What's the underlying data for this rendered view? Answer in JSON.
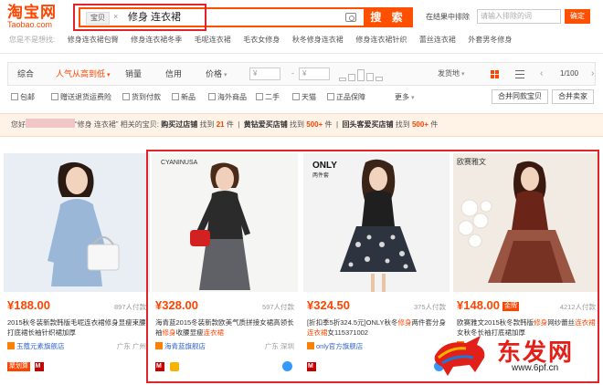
{
  "header": {
    "logo_cn": "淘宝网",
    "logo_en": "Taobao.com",
    "search": {
      "scope": "宝贝",
      "clear": "×",
      "query": "修身 连衣裙",
      "button": "搜 索"
    },
    "within": {
      "label": "在结果中排除",
      "placeholder": "请输入排除的词",
      "button": "确定"
    }
  },
  "suggestions": [
    "您是不是想找:",
    "修身连衣裙包臀",
    "修身连衣裙冬季",
    "毛呢连衣裙",
    "毛衣女修身",
    "秋冬修身连衣裙",
    "修身连衣裙针织",
    "蕾丝连衣裙",
    "外套男冬修身"
  ],
  "sortbar": {
    "tabs": [
      "综合",
      "人气从高到低",
      "销量",
      "信用",
      "价格"
    ],
    "active": 1,
    "price_from": "¥",
    "price_to": "¥",
    "location": "发货地",
    "page": "1/100",
    "prev": "‹",
    "next": "›",
    "arrow": "▾"
  },
  "filters": {
    "checks": [
      "包邮",
      "赠送退货运费险",
      "货到付款",
      "新品",
      "海外商品",
      "二手",
      "天猫",
      "正品保障"
    ],
    "more": "更多",
    "merge_same": "合并同款宝贝",
    "merge_seller": "合并卖家"
  },
  "notice": {
    "prefix": "您好",
    "query_part": "“修身 连衣裙” 相关的宝贝: ",
    "segments": [
      {
        "label": "购买过店铺",
        "pre": "找到",
        "count": "21",
        "post": "件"
      },
      {
        "label": "黄钻爱买店铺",
        "pre": "找到",
        "count": "500+",
        "post": "件"
      },
      {
        "label": "回头客爱买店铺",
        "pre": "找到",
        "count": "500+",
        "post": "件"
      }
    ]
  },
  "products": [
    {
      "price": "¥188.00",
      "paid": "897人付款",
      "title_parts": [
        "2015秋冬装新款韩版毛呢连衣裙修身显瘦束腰打底裙长袖针织裙加厚"
      ],
      "shop": "玉蔻元素旗舰店",
      "location": "广东 广州",
      "badge": "聚划算",
      "badge_color": "#ff4400",
      "colors": {
        "bg": "#e9eef5",
        "dress": "#9ab7d8",
        "hair": "#2a1a12",
        "skin": "#f1d3be",
        "bag": "#f7f7f7"
      }
    },
    {
      "price": "¥328.00",
      "paid": "597人付款",
      "title_parts": [
        "海青蓝2015冬装新款欧美气质拼接女裙高领长袖",
        "修身",
        "收腰显瘦",
        "连衣裙"
      ],
      "shop": "海青蓝旗舰店",
      "location": "广东 深圳",
      "brand": "CYANINUSA",
      "colors": {
        "bg": "#f5f5f3",
        "dress": "#2b2b2b",
        "skirt": "#5f6166",
        "bag": "#d32020",
        "skin": "#f0d0ba"
      }
    },
    {
      "price": "¥324.50",
      "paid": "375人付款",
      "title_parts": [
        "[折扣季5折324.5元]ONLY秋冬",
        "修身",
        "两件套分身",
        "连衣裙",
        "女115371002"
      ],
      "shop": "only官方旗舰店",
      "location": "",
      "brand": "ONLY",
      "brand_sub": "两件套",
      "colors": {
        "bg": "#f3f3f3",
        "top": "#1f1f1f",
        "skirt": "#2e3340",
        "dots": "#d9d9d9",
        "hair": "#3a2418"
      }
    },
    {
      "price": "¥148.00",
      "jin": "金牌",
      "paid": "4212人付款",
      "title_parts": [
        "欧赛雅文2015秋冬款韩版",
        "修身",
        "网纱蕾丝",
        "连衣裙",
        "女秋冬长袖打底裙加厚"
      ],
      "shop": "",
      "location": "",
      "brand": "欧赛雅文",
      "colors": {
        "bg": "#f2ebe4",
        "dress": "#6a2418",
        "lace": "#8a3a26",
        "flower": "#ffffff",
        "skin": "#f1d3be"
      }
    }
  ],
  "watermark": {
    "text": "东发网",
    "url": "www.6pf.cn"
  }
}
